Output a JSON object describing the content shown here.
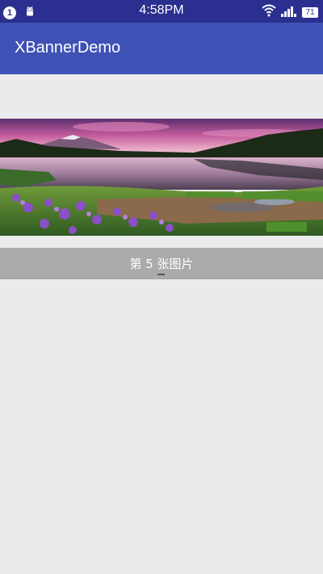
{
  "status_bar": {
    "notification_count": "1",
    "time": "4:58PM",
    "battery_level": "71",
    "icons": [
      "notification-badge-icon",
      "android-icon",
      "wifi-icon",
      "signal-icon",
      "battery-icon"
    ],
    "background_color": "#2b2f8f"
  },
  "app_bar": {
    "title": "XBannerDemo",
    "background_color": "#3f51b5"
  },
  "banner": {
    "image": "landscape-mountain-lake-icon",
    "caption": "第 5 张图片",
    "caption_bar_color": "#aaaaaa",
    "indicator_color": "#555555"
  }
}
